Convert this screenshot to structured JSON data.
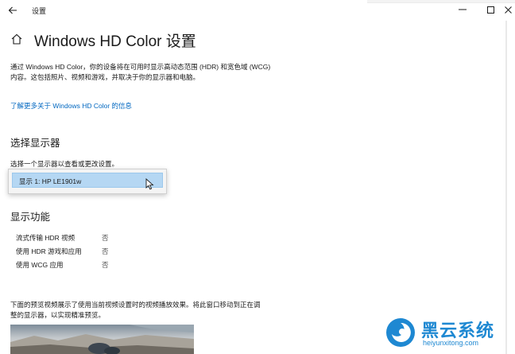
{
  "window": {
    "title": "设置"
  },
  "page": {
    "title": "Windows HD Color 设置",
    "description": "通过 Windows HD Color，你的设备将在可用时显示高动态范围 (HDR) 和宽色域 (WCG) 内容。这包括照片、视频和游戏，并取决于你的显示器和电脑。",
    "info_link": "了解更多关于 Windows HD Color 的信息"
  },
  "display_section": {
    "title": "选择显示器",
    "label": "选择一个显示器以查看或更改设置。",
    "selected_option": "显示 1: HP LE1901w"
  },
  "features_section": {
    "title": "显示功能",
    "rows": [
      {
        "label": "流式传输 HDR 视频",
        "value": "否"
      },
      {
        "label": "使用 HDR 游戏和应用",
        "value": "否"
      },
      {
        "label": "使用 WCG 应用",
        "value": "否"
      }
    ]
  },
  "preview": {
    "description": "下面的预览视频展示了使用当前视频设置时的视频播放效果。将此窗口移动到正在调整的显示器，以实现精准预览。"
  },
  "watermark": {
    "brand": "黑云系统",
    "url": "heiyunxitong.com"
  },
  "colors": {
    "accent_link": "#0067c0",
    "selection": "#b5d7f3",
    "watermark": "#1e88d2"
  },
  "icons": {
    "back": "back-arrow-icon",
    "home": "home-icon",
    "minimize": "minimize-icon",
    "maximize": "maximize-icon",
    "close": "close-icon",
    "cursor": "mouse-cursor-icon"
  }
}
